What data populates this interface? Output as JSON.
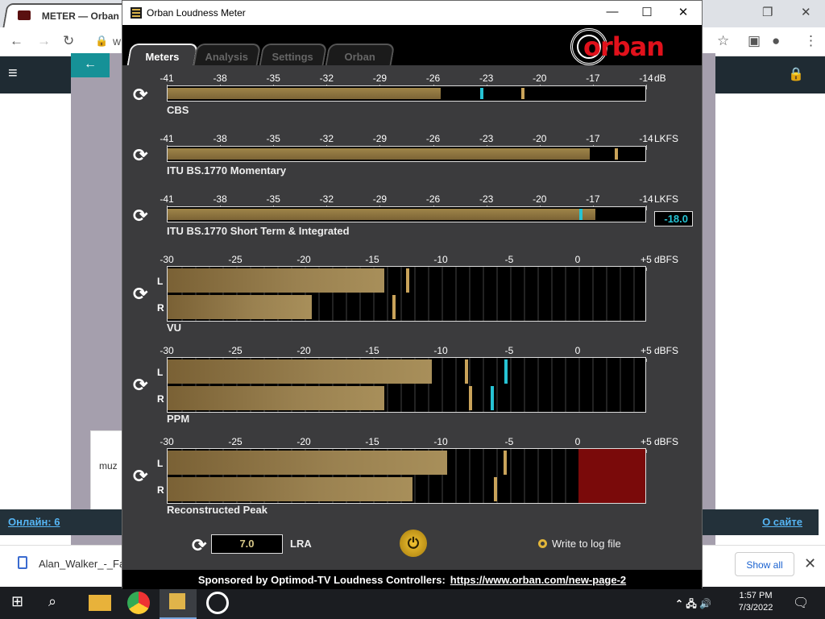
{
  "browser": {
    "tab_title": "METER — Orban",
    "address_prefix": "w",
    "stats_left": "Онлайн: 6",
    "stats_right": "О сайте",
    "ad_text": "muz",
    "download_file": "Alan_Walker_-_Fa...",
    "show_all": "Show all"
  },
  "window": {
    "title": "Orban Loudness Meter",
    "minimize": "—",
    "maximize": "☐",
    "close": "✕"
  },
  "tabs": [
    "Meters",
    "Analysis",
    "Settings",
    "Orban"
  ],
  "active_tab": "Meters",
  "logo_text": "orban",
  "loudness_ticks": [
    "-41",
    "-38",
    "-35",
    "-32",
    "-29",
    "-26",
    "-23",
    "-20",
    "-17",
    "-14"
  ],
  "dbfs_ticks": [
    "-30",
    "-25",
    "-20",
    "-15",
    "-10",
    "-5",
    "0",
    "+5"
  ],
  "meters": {
    "cbs": {
      "label": "CBS",
      "unit": "dB",
      "fill": -25.6,
      "peaks": [
        -23.4,
        -21.1
      ]
    },
    "momentary": {
      "label": "ITU BS.1770 Momentary",
      "unit": "LKFS",
      "fill": -17.2,
      "peaks": [
        -15.8
      ]
    },
    "shortterm": {
      "label": "ITU BS.1770 Short Term & Integrated",
      "unit": "LKFS",
      "fill": -16.9,
      "peaks": [
        -17.8
      ],
      "readout": "-18.0"
    },
    "vu": {
      "label": "VU",
      "unit": "dBFS",
      "L": -14.2,
      "R": -19.5,
      "peakL": -12.6,
      "peakR": -13.6
    },
    "ppm": {
      "label": "PPM",
      "unit": "dBFS",
      "L": -10.7,
      "R": -14.2,
      "peakL": -8.3,
      "peakR": -8.0,
      "cyL": -5.4,
      "cyR": -6.4
    },
    "recon": {
      "label": "Reconstructed Peak",
      "unit": "dBFS",
      "L": -9.6,
      "R": -12.1,
      "peakL": -5.5,
      "peakR": -6.2,
      "red_from": 0
    }
  },
  "channels": {
    "left": "L",
    "right": "R"
  },
  "lra": {
    "value": "7.0",
    "label": "LRA"
  },
  "log_option": "Write to log file",
  "footer": {
    "text": "Sponsored by Optimod-TV Loudness Controllers:",
    "link": "https://www.orban.com/new-page-2"
  },
  "taskbar": {
    "time": "1:57 PM",
    "date": "7/3/2022"
  },
  "colors": {
    "accent": "#c9a35a",
    "peak_cyan": "#26c3d4",
    "logo_red": "#e0111b",
    "over_red": "#7a0a0a"
  }
}
